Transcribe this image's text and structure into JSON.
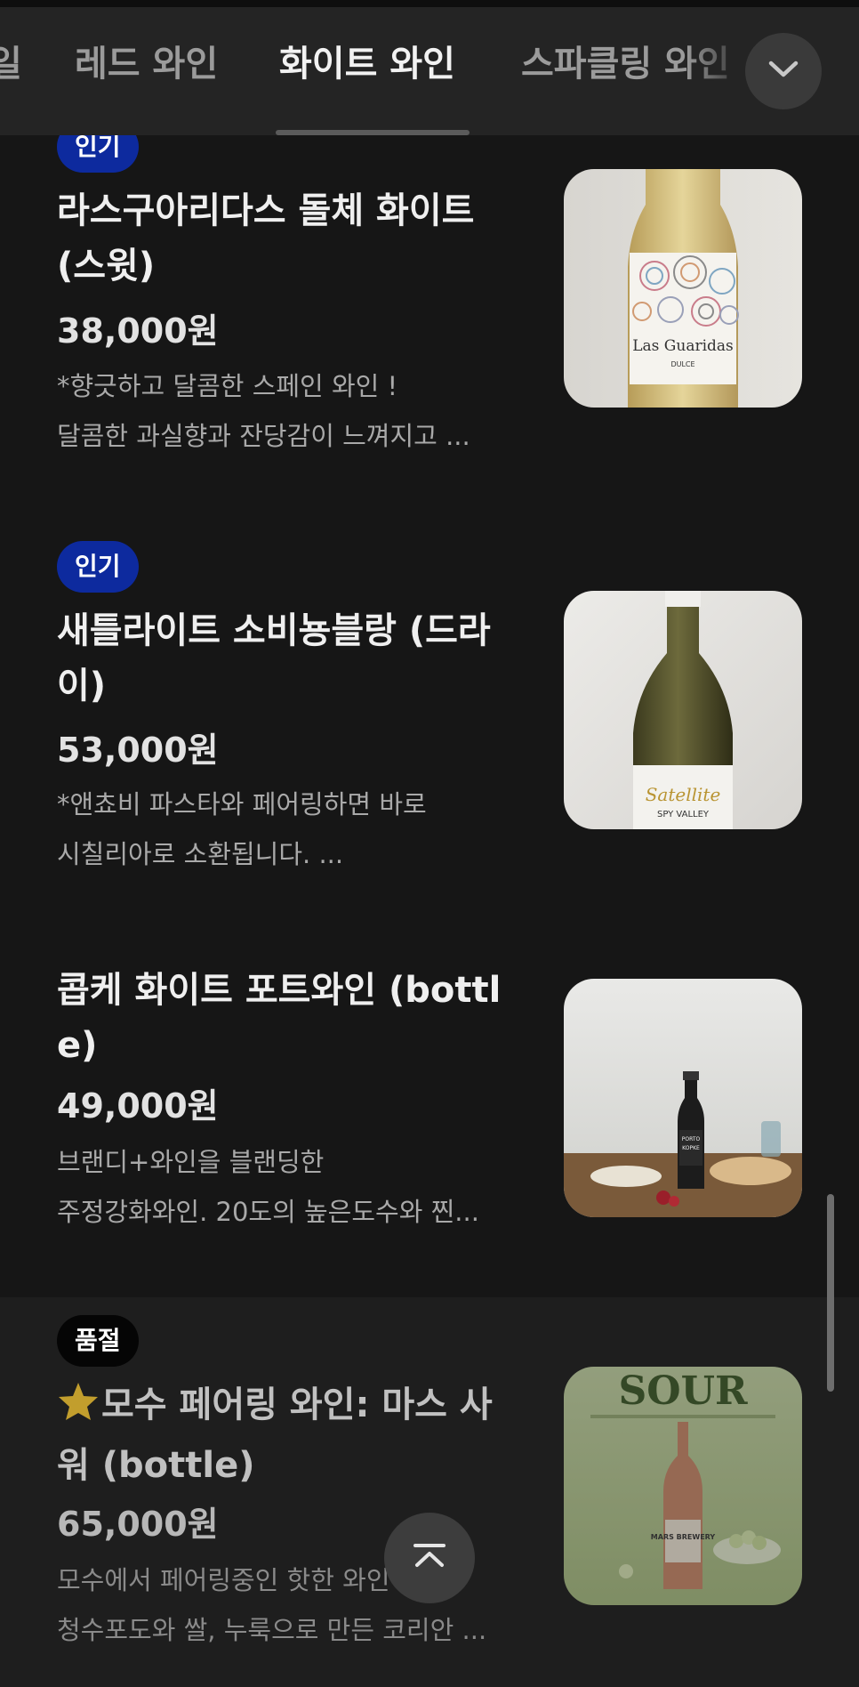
{
  "tabs": [
    {
      "label": "일"
    },
    {
      "label": "레드 와인"
    },
    {
      "label": "화이트 와인",
      "active": true
    },
    {
      "label": "스파클링 와인"
    }
  ],
  "icons": {
    "expand": "chevron-down-icon",
    "scroll_top": "arrow-up-to-top-icon",
    "star": "star-icon"
  },
  "colors": {
    "background": "#161616",
    "tab_bar": "#242424",
    "badge_popular": "#0d2a9e",
    "badge_soldout": "#050505"
  },
  "items": [
    {
      "badge": "인기",
      "title": "라스구아리다스 돌체 화이트 (스윗)",
      "price": "38,000원",
      "desc_line1": "*향긋하고 달콤한 스페인 와인 !",
      "desc_line2": "달콤한 과실향과 잔당감이 느껴지고 ...",
      "label_main": "Las Guaridas",
      "label_sub": "DULCE"
    },
    {
      "badge": "인기",
      "title": "새틀라이트 소비뇽블랑 (드라이)",
      "price": "53,000원",
      "desc_line1": "*앤쵸비 파스타와 페어링하면 바로",
      "desc_line2": "시칠리아로 소환됩니다. ...",
      "label_main": "Satellite",
      "label_sub": "SPY VALLEY"
    },
    {
      "title": "콥케 화이트 포트와인 (bottle)",
      "price": "49,000원",
      "desc_line1": "브랜디+와인을 블랜딩한",
      "desc_line2": "주정강화와인. 20도의 높은도수와 찐...",
      "label_main": "PORTO",
      "label_sub": "KOPKE"
    },
    {
      "badge": "품절",
      "title": "모수 페어링 와인: 마스 사워 (bottle)",
      "price": "65,000원",
      "desc_line1": "모수에서 페어링중인 핫한 와인",
      "desc_line2": "청수포도와 쌀, 누룩으로 만든 코리안 ...",
      "label_main": "SOUR",
      "label_sub": "MARS BREWERY"
    }
  ]
}
